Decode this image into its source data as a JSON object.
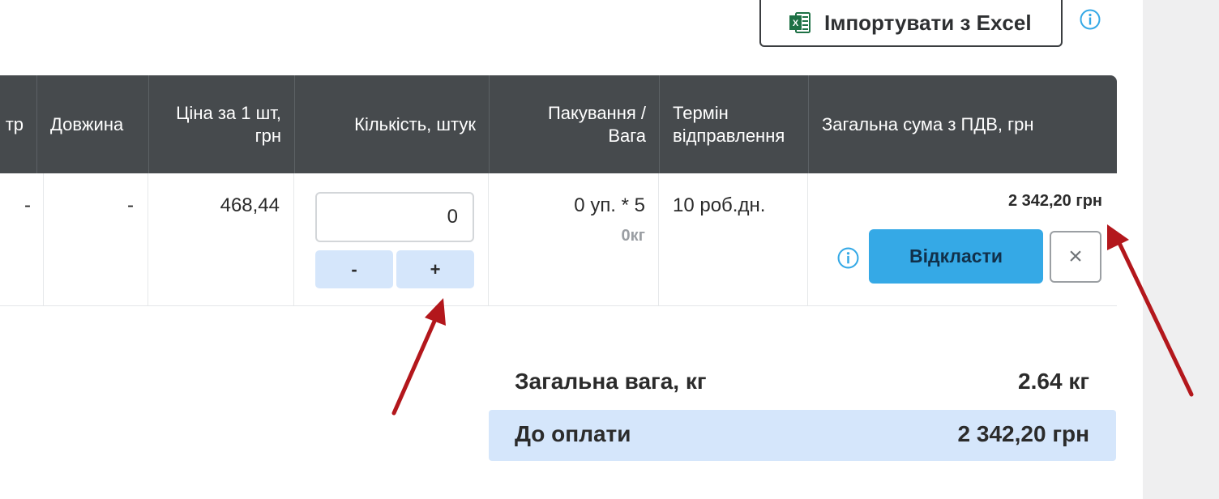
{
  "toolbar": {
    "import_label": "Імпортувати з Excel",
    "import_icon": "excel-icon",
    "info_icon": "info-icon"
  },
  "table": {
    "headers": [
      "тр",
      "Довжина",
      "Ціна за 1 шт, грн",
      "Кількість, штук",
      "Пакування / Вага",
      "Термін відправлення",
      "Загальна сума з ПДВ, грн"
    ],
    "row": {
      "diameter": "-",
      "length": "-",
      "unit_price": "468,44",
      "quantity": "0",
      "decrement_label": "-",
      "increment_label": "+",
      "packaging": "0 уп. * 5",
      "weight": "0кг",
      "ship_term": "10 роб.дн.",
      "total": "2 342,20 грн",
      "defer_label": "Відкласти",
      "remove_label": "×"
    }
  },
  "summary": {
    "weight_label": "Загальна вага, кг",
    "weight_value": "2.64 кг",
    "pay_label": "До оплати",
    "pay_value": "2 342,20 грн"
  },
  "colors": {
    "header_bg": "#464a4d",
    "accent_blue": "#35a9e6",
    "light_blue": "#d5e6fb",
    "annotation_arrow": "#b3171c"
  }
}
